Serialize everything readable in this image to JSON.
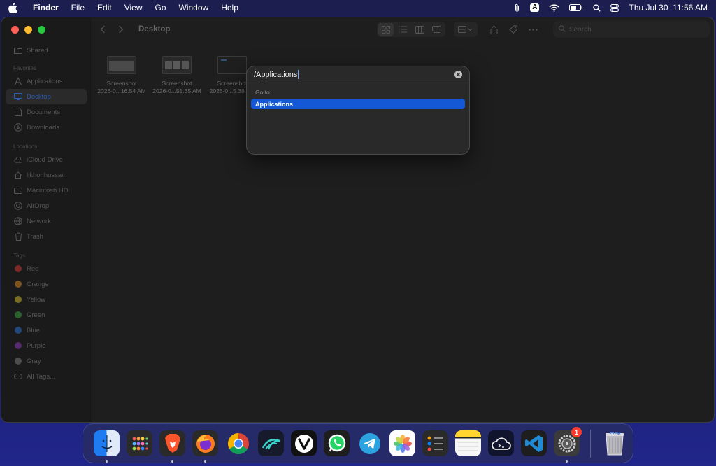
{
  "menubar": {
    "app_name": "Finder",
    "menus": [
      "File",
      "Edit",
      "View",
      "Go",
      "Window",
      "Help"
    ],
    "input_badge": "A",
    "clock": "Thu Jul 30  11:56 AM"
  },
  "window": {
    "title": "Desktop",
    "search_placeholder": "Search"
  },
  "sidebar": {
    "top_item": "Shared",
    "favorites_heading": "Favorites",
    "favorites": [
      {
        "label": "Applications",
        "icon": "applications-icon"
      },
      {
        "label": "Desktop",
        "icon": "desktop-icon",
        "selected": true
      },
      {
        "label": "Documents",
        "icon": "documents-icon"
      },
      {
        "label": "Downloads",
        "icon": "downloads-icon"
      }
    ],
    "locations_heading": "Locations",
    "locations": [
      {
        "label": "iCloud Drive",
        "icon": "cloud-icon"
      },
      {
        "label": "likhonhussain",
        "icon": "home-icon"
      },
      {
        "label": "Macintosh HD",
        "icon": "disk-icon"
      },
      {
        "label": "AirDrop",
        "icon": "airdrop-icon"
      },
      {
        "label": "Network",
        "icon": "network-icon"
      },
      {
        "label": "Trash",
        "icon": "trash-icon"
      }
    ],
    "tags_heading": "Tags",
    "tags": [
      {
        "label": "Red",
        "color": "#8a2d2a"
      },
      {
        "label": "Orange",
        "color": "#8a5a22"
      },
      {
        "label": "Yellow",
        "color": "#8a7a22"
      },
      {
        "label": "Green",
        "color": "#2d6a2f"
      },
      {
        "label": "Blue",
        "color": "#234e8a"
      },
      {
        "label": "Purple",
        "color": "#5e2d7a"
      },
      {
        "label": "Gray",
        "color": "#555555"
      }
    ],
    "all_tags": "All Tags..."
  },
  "files": [
    {
      "name": "Screenshot",
      "date": "2026-0...16.54 AM"
    },
    {
      "name": "Screenshot",
      "date": "2026-0...51.35 AM"
    },
    {
      "name": "Screenshot",
      "date": "2026-0...5.38 AM"
    }
  ],
  "goto_dialog": {
    "input_value": "/Applications",
    "section_label": "Go to:",
    "suggestion": "Applications"
  },
  "dock": {
    "apps": [
      {
        "name": "Finder",
        "running": true
      },
      {
        "name": "Launchpad",
        "running": false
      },
      {
        "name": "Brave",
        "running": true
      },
      {
        "name": "Firefox",
        "running": true
      },
      {
        "name": "Chrome",
        "running": false
      },
      {
        "name": "Surfshark",
        "running": false
      },
      {
        "name": "Vivaldi",
        "running": false
      },
      {
        "name": "WhatsApp",
        "running": false
      },
      {
        "name": "Telegram",
        "running": false
      },
      {
        "name": "Photos",
        "running": false
      },
      {
        "name": "Reminders",
        "running": false
      },
      {
        "name": "Notes",
        "running": false
      },
      {
        "name": "ChatGPT",
        "running": false
      },
      {
        "name": "VS Code",
        "running": false
      },
      {
        "name": "System Settings",
        "running": true,
        "badge": "1"
      }
    ],
    "trash": "Trash"
  }
}
